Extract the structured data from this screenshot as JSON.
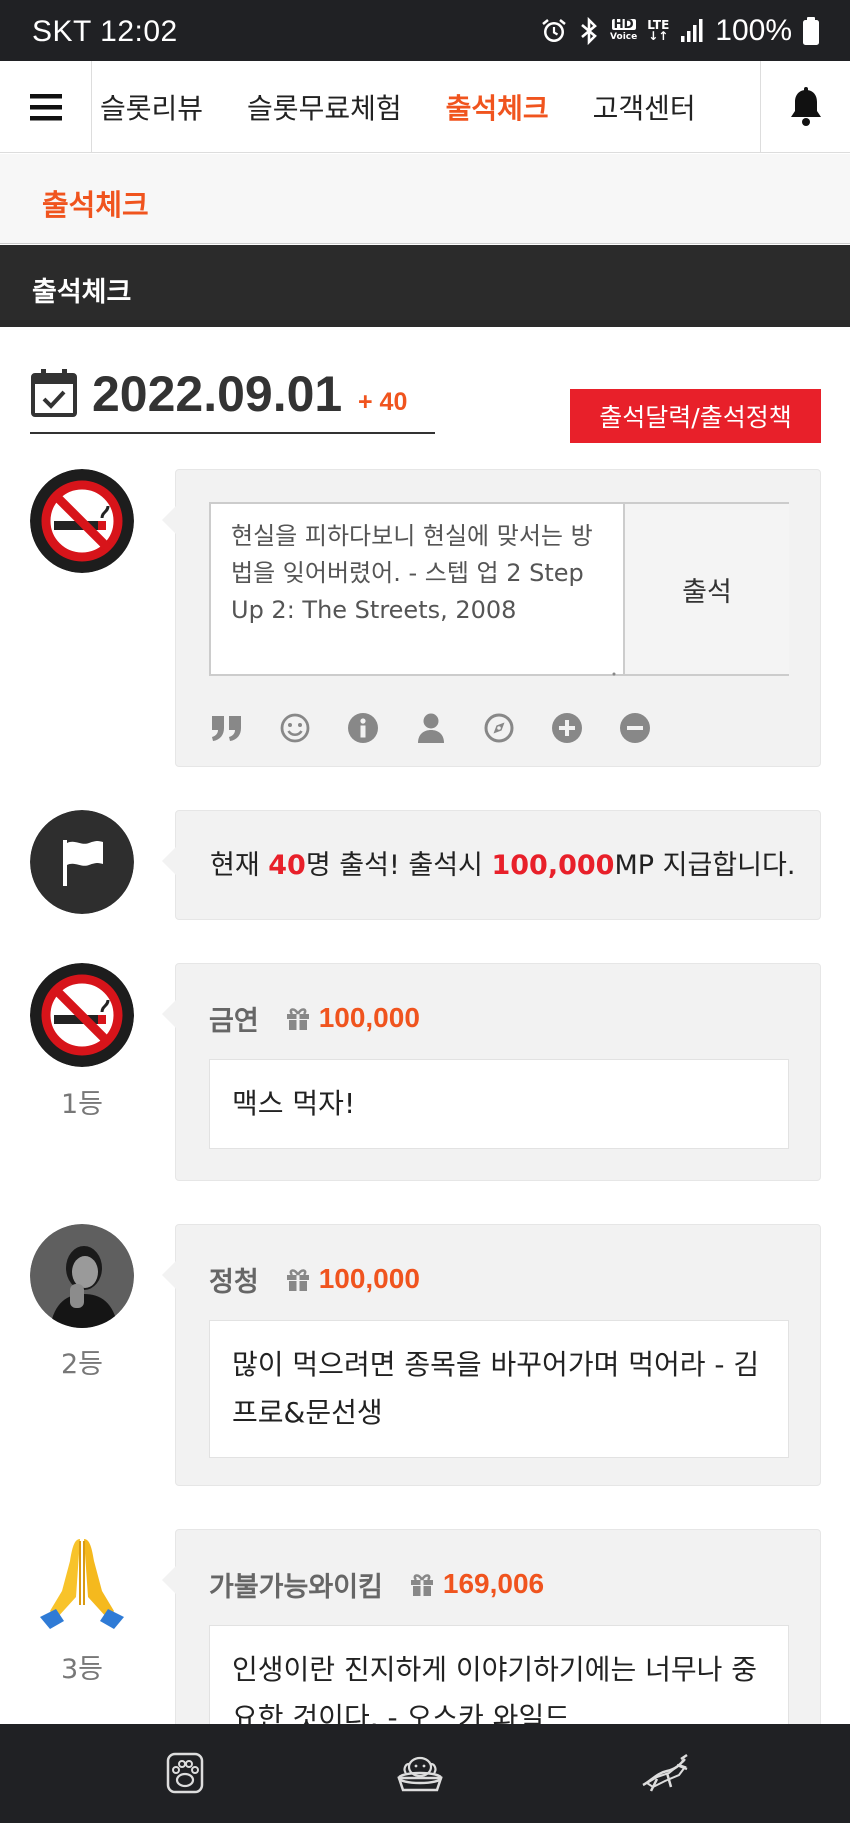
{
  "status_bar": {
    "carrier_time": "SKT 12:02",
    "hd_label": "HD",
    "voice_label": "Voice",
    "lte_label": "LTE",
    "battery": "100%",
    "icons": [
      "alarm-icon",
      "bluetooth-icon",
      "signal-icon",
      "battery-icon"
    ]
  },
  "nav": {
    "items": [
      "슬롯리뷰",
      "슬롯무료체험",
      "출석체크",
      "고객센터"
    ],
    "active_index": 2,
    "menu_icon": "hamburger-menu-icon",
    "bell_icon": "bell-icon"
  },
  "breadcrumb": {
    "title": "출석체크"
  },
  "section": {
    "title": "출석체크"
  },
  "attendance": {
    "date": "2022.09.01",
    "count_badge": "+ 40",
    "policy_button": "출석달력/출석정책"
  },
  "composer": {
    "quote": "현실을 피하다보니 현실에 맞서는 방법을 잊어버렸어. - 스텝 업 2  Step Up 2: The Streets, 2008",
    "submit_label": "출석",
    "tools": [
      "quote-icon",
      "smile-icon",
      "info-icon",
      "user-icon",
      "compass-icon",
      "plus-circle-icon",
      "minus-circle-icon"
    ]
  },
  "notice": {
    "prefix": "현재 ",
    "count": "40",
    "mid": "명 출석! 출석시 ",
    "reward": "100,000",
    "suffix": "MP 지급합니다."
  },
  "entries": [
    {
      "rank": "1등",
      "name": "금연",
      "points": "100,000",
      "message": "맥스 먹자!",
      "avatar": "no-smoking-avatar"
    },
    {
      "rank": "2등",
      "name": "정청",
      "points": "100,000",
      "message": "많이 먹으려면 종목을 바꾸어가며 먹어라 - 김프로&문선생",
      "avatar": "photo-avatar"
    },
    {
      "rank": "3등",
      "name": "가불가능와이킴",
      "points": "169,006",
      "message": "인생이란 진지하게 이야기하기에는 너무나 중요한 것이다. - 오스카 와일드",
      "avatar": "praying-hands-avatar"
    }
  ],
  "bottom_nav": {
    "icons": [
      "paw-icon",
      "dog-bowl-icon",
      "dog-running-icon"
    ]
  },
  "colors": {
    "accent": "#f0541e",
    "red": "#e8202a",
    "dark": "#2b2b2b"
  }
}
